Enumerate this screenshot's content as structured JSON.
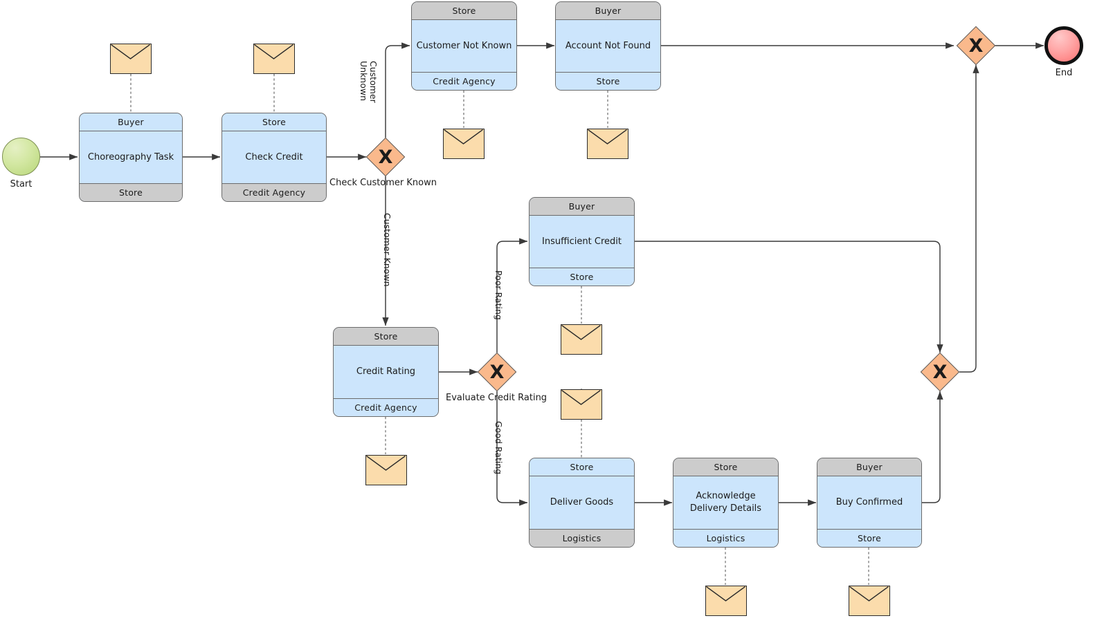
{
  "diagram": {
    "title": "BPMN Choreography Diagram",
    "colors": {
      "task_blue": "#cce5fc",
      "band_gray": "#cccccc",
      "gateway_fill": "#fab98c",
      "start_green": "#b7d678",
      "end_red": "#ff7272",
      "message_tan": "#fbdcac",
      "stroke": "#5a5a5a"
    }
  },
  "events": {
    "start": {
      "label": "Start",
      "type": "start-event"
    },
    "end": {
      "label": "End",
      "type": "end-event"
    }
  },
  "gateways": [
    {
      "id": "gw_check_customer",
      "marker": "X",
      "label": "Check Customer Known",
      "type": "exclusive-gateway"
    },
    {
      "id": "gw_evaluate_credit",
      "marker": "X",
      "label": "Evaluate Credit Rating",
      "type": "exclusive-gateway"
    },
    {
      "id": "gw_merge_lower",
      "marker": "X",
      "label": "",
      "type": "exclusive-gateway"
    },
    {
      "id": "gw_merge_upper",
      "marker": "X",
      "label": "",
      "type": "exclusive-gateway"
    }
  ],
  "tasks": [
    {
      "id": "choreography_task",
      "name": "Choreography Task",
      "initiator": "Buyer",
      "participant": "Store",
      "top_band_style": "blue",
      "bottom_band_style": "gray",
      "has_message": true
    },
    {
      "id": "check_credit",
      "name": "Check Credit",
      "initiator": "Store",
      "participant": "Credit Agency",
      "top_band_style": "blue",
      "bottom_band_style": "gray",
      "has_message": true
    },
    {
      "id": "customer_not_known",
      "name": "Customer Not Known",
      "initiator": "Store",
      "participant": "Credit Agency",
      "top_band_style": "gray",
      "bottom_band_style": "blue",
      "has_message": true
    },
    {
      "id": "account_not_found",
      "name": "Account Not Found",
      "initiator": "Buyer",
      "participant": "Store",
      "top_band_style": "gray",
      "bottom_band_style": "blue",
      "has_message": true
    },
    {
      "id": "insufficient_credit",
      "name": "Insufficient Credit",
      "initiator": "Buyer",
      "participant": "Store",
      "top_band_style": "gray",
      "bottom_band_style": "blue",
      "has_message": true
    },
    {
      "id": "credit_rating",
      "name": "Credit Rating",
      "initiator": "Store",
      "participant": "Credit Agency",
      "top_band_style": "gray",
      "bottom_band_style": "blue",
      "has_message": true
    },
    {
      "id": "deliver_goods",
      "name": "Deliver Goods",
      "initiator": "Store",
      "participant": "Logistics",
      "top_band_style": "blue",
      "bottom_band_style": "gray",
      "has_message": true
    },
    {
      "id": "acknowledge_delivery_details",
      "name": "Acknowledge\nDelivery Details",
      "initiator": "Store",
      "participant": "Logistics",
      "top_band_style": "gray",
      "bottom_band_style": "blue",
      "has_message": true
    },
    {
      "id": "buy_confirmed",
      "name": "Buy Confirmed",
      "initiator": "Buyer",
      "participant": "Store",
      "top_band_style": "gray",
      "bottom_band_style": "blue",
      "has_message": true
    }
  ],
  "flow_labels": {
    "customer_unknown": "Customer\nUnknown",
    "customer_known": "Customer Known",
    "poor_rating": "Poor Rating",
    "good_rating": "Good Rating"
  }
}
